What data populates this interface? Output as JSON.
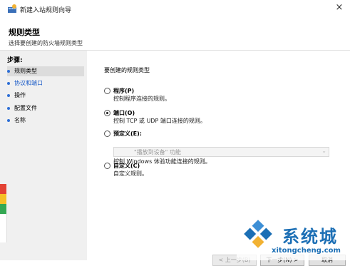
{
  "window": {
    "title": "新建入站规则向导",
    "close_glyph": "×"
  },
  "header": {
    "title": "规则类型",
    "subtitle": "选择要创建的防火墙规则类型"
  },
  "steps": {
    "heading": "步骤:",
    "items": [
      {
        "label": "规则类型"
      },
      {
        "label": "协议和端口"
      },
      {
        "label": "操作"
      },
      {
        "label": "配置文件"
      },
      {
        "label": "名称"
      }
    ]
  },
  "main": {
    "prompt": "要创建的规则类型",
    "options": [
      {
        "label": "程序(P)",
        "description": "控制程序连接的规则。",
        "selected": false
      },
      {
        "label": "端口(O)",
        "description": "控制 TCP 或 UDP 端口连接的规则。",
        "selected": true
      },
      {
        "label": "预定义(E):",
        "combo_value": "\"播放到设备\" 功能",
        "description": "控制 Windows 体验功能连接的规则。",
        "selected": false
      },
      {
        "label": "自定义(C)",
        "description": "自定义规则。",
        "selected": false
      }
    ]
  },
  "buttons": {
    "back": "< 上一步(B)",
    "next": "下一步(N) >",
    "cancel": "取消"
  },
  "watermark": {
    "brand": "系统城",
    "url": "xitongcheng.com"
  },
  "colors": {
    "accent": "#2e6fd6",
    "watermark": "#1c6fb5",
    "steps_bg": "#f0f0f0"
  }
}
